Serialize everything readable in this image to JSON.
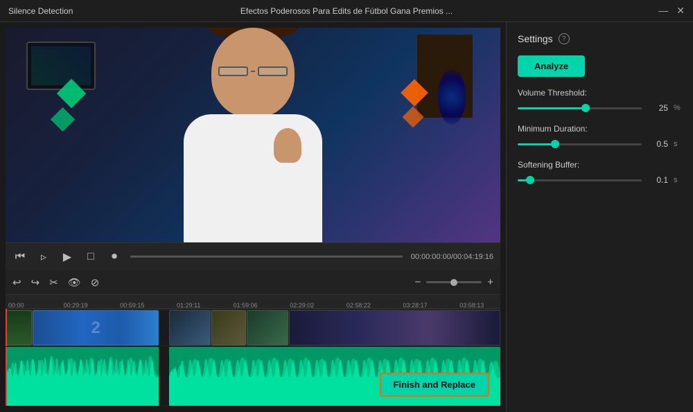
{
  "titleBar": {
    "appTitle": "Silence Detection",
    "videoTitle": "Efectos Poderosos Para Edits de Fútbol   Gana Premios ...",
    "minimizeLabel": "—",
    "closeLabel": "✕"
  },
  "videoControls": {
    "timeDisplay": "00:00:00:00/00:04:19:16"
  },
  "settings": {
    "title": "Settings",
    "helpIcon": "?",
    "analyzeLabel": "Analyze",
    "volumeThreshold": {
      "label": "Volume Threshold:",
      "value": 25,
      "unit": "%",
      "fillPercent": 55
    },
    "minimumDuration": {
      "label": "Minimum Duration:",
      "value": "0.5",
      "unit": "s",
      "fillPercent": 30
    },
    "softeningBuffer": {
      "label": "Softening Buffer:",
      "value": "0.1",
      "unit": "s",
      "fillPercent": 10
    }
  },
  "timeline": {
    "rulerMarks": [
      "00:00",
      "00:29:19",
      "00:59:15",
      "01:29:11",
      "01:59:06",
      "02:29:02",
      "02:58:22",
      "03:28:17",
      "03:58:13"
    ],
    "zoomLevel": 50
  },
  "finishButton": {
    "label": "Finish and Replace"
  },
  "toolbar": {
    "undoIcon": "↩",
    "redoIcon": "↪",
    "cutIcon": "✂",
    "eyeIcon": "👁",
    "disableIcon": "⊘",
    "minusIcon": "−",
    "plusIcon": "+"
  }
}
